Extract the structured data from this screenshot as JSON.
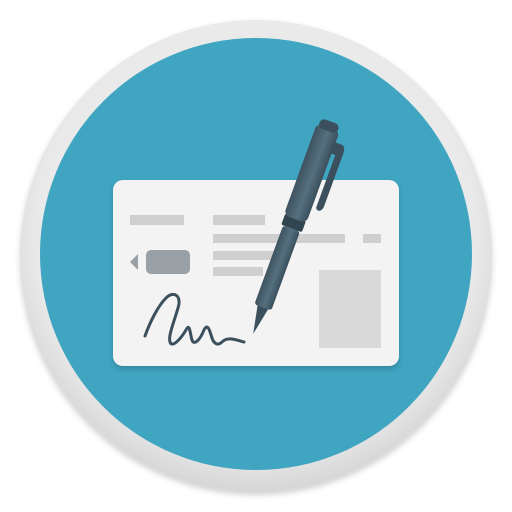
{
  "icon": {
    "name": "signed-document-app-icon",
    "colors": {
      "ring": "#e6e6e6",
      "ring_shadow": "#cfcfcf",
      "disc": "#3fa5c1",
      "card": "#f3f3f3",
      "card_lines": "#cfcfcf",
      "tag": "#9aa1a6",
      "photo_box": "#d9d9d9",
      "signature": "#3b4f5c",
      "pen_body": "#455a66",
      "pen_cap": "#3b4f5c"
    }
  }
}
